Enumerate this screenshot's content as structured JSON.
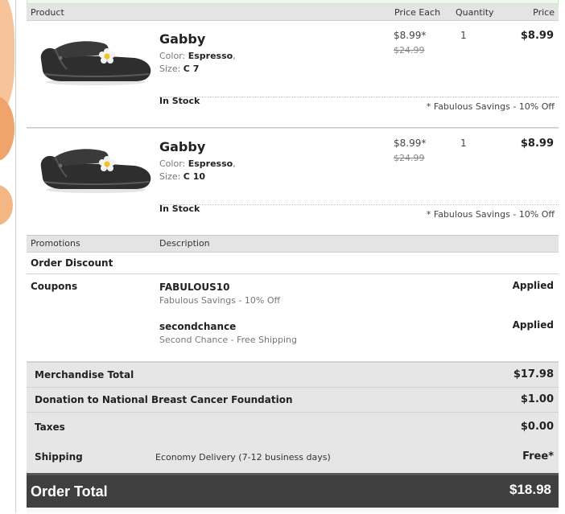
{
  "table_header": {
    "product": "Product",
    "price_each": "Price Each",
    "quantity": "Quantity",
    "price": "Price"
  },
  "items": [
    {
      "name": "Gabby",
      "color_label": "Color:",
      "color_value": "Espresso",
      "color_suffix": ",",
      "size_label": "Size:",
      "size_value": "C 7",
      "stock": "In Stock",
      "price_each": "$8.99*",
      "original_price": "$24.99",
      "quantity": "1",
      "price": "$8.99",
      "savings_note": "* Fabulous Savings - 10% Off"
    },
    {
      "name": "Gabby",
      "color_label": "Color:",
      "color_value": "Espresso",
      "color_suffix": ",",
      "size_label": "Size:",
      "size_value": "C 10",
      "stock": "In Stock",
      "price_each": "$8.99*",
      "original_price": "$24.99",
      "quantity": "1",
      "price": "$8.99",
      "savings_note": "* Fabulous Savings - 10% Off"
    }
  ],
  "promotions": {
    "header_promotions": "Promotions",
    "header_description": "Description",
    "order_discount": "Order Discount",
    "coupons_label": "Coupons",
    "coupons": [
      {
        "code": "FABULOUS10",
        "description": "Fabulous Savings - 10% Off",
        "status": "Applied"
      },
      {
        "code": "secondchance",
        "description": "Second Chance - Free Shipping",
        "status": "Applied"
      }
    ]
  },
  "totals": {
    "merchandise_label": "Merchandise Total",
    "merchandise_value": "$17.98",
    "donation_label": "Donation to National Breast Cancer Foundation",
    "donation_value": "$1.00",
    "taxes_label": "Taxes",
    "taxes_value": "$0.00",
    "shipping_label": "Shipping",
    "shipping_method": "Economy Delivery (7-12 business days)",
    "shipping_value": "Free*",
    "order_total_label": "Order Total",
    "order_total_value": "$18.98"
  },
  "colors": {
    "shoe": "#2e2e2e",
    "flower_petal": "#f3f3f3",
    "flower_center": "#f0c419",
    "order_total_bar": "#3f3f3f"
  },
  "icons": {
    "product_image": "black-clog-with-daisy-icon"
  }
}
